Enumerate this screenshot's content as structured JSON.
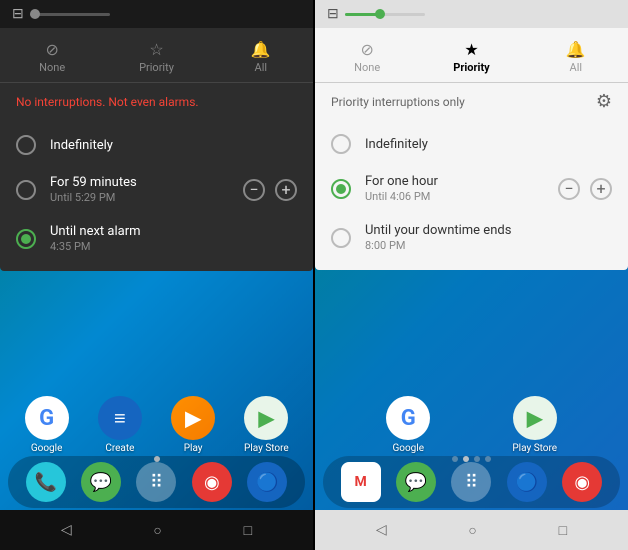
{
  "left_panel": {
    "status_bar": {
      "vibrate_symbol": "📳",
      "slider_fill_pct": 0
    },
    "tabs": [
      {
        "id": "none",
        "icon": "⊘",
        "label": "None",
        "active": false
      },
      {
        "id": "priority",
        "icon": "★",
        "label": "Priority",
        "active": false
      },
      {
        "id": "all",
        "icon": "🔔",
        "label": "All",
        "active": false
      }
    ],
    "alert_message": "No interruptions. Not even alarms.",
    "options": [
      {
        "id": "indefinitely",
        "label": "Indefinitely",
        "sub": "",
        "selected": false,
        "has_stepper": false
      },
      {
        "id": "59min",
        "label": "For 59 minutes",
        "sub": "Until 5:29 PM",
        "selected": false,
        "has_stepper": true
      },
      {
        "id": "next_alarm",
        "label": "Until next alarm",
        "sub": "4:35 PM",
        "selected": true,
        "has_stepper": false
      }
    ],
    "apps_row1": [
      {
        "name": "Google",
        "bg": "#fff",
        "text": "G",
        "text_color": "#4285F4"
      },
      {
        "name": "Create",
        "bg": "#1565C0",
        "text": "≡",
        "text_color": "#fff"
      },
      {
        "name": "Play",
        "bg": "#ff8f00",
        "text": "▶",
        "text_color": "#fff"
      },
      {
        "name": "Play Store",
        "bg": "#e8f5e9",
        "text": "▶",
        "text_color": "#4CAF50"
      }
    ],
    "nav": {
      "back": "◁",
      "home": "○",
      "recents": "□"
    }
  },
  "right_panel": {
    "status_bar": {
      "vibrate_symbol": "📳",
      "slider_fill_pct": 40
    },
    "tabs": [
      {
        "id": "none",
        "icon": "⊘",
        "label": "None",
        "active": false
      },
      {
        "id": "priority",
        "icon": "★",
        "label": "Priority",
        "active": true
      },
      {
        "id": "all",
        "icon": "🔔",
        "label": "All",
        "active": false
      }
    ],
    "priority_info": "Priority interruptions only",
    "gear_label": "⚙",
    "options": [
      {
        "id": "indefinitely",
        "label": "Indefinitely",
        "sub": "",
        "selected": false,
        "has_stepper": false
      },
      {
        "id": "one_hour",
        "label": "For one hour",
        "sub": "Until 4:06 PM",
        "selected": true,
        "has_stepper": true
      },
      {
        "id": "downtime",
        "label": "Until your downtime ends",
        "sub": "8:00 PM",
        "selected": false,
        "has_stepper": false
      }
    ],
    "apps_row1": [
      {
        "name": "Google",
        "bg": "#fff",
        "text": "G",
        "text_color": "#4285F4"
      },
      {
        "name": "Play Store",
        "bg": "#e8f5e9",
        "text": "▶",
        "text_color": "#4CAF50"
      }
    ],
    "nav": {
      "back": "◁",
      "home": "○",
      "recents": "□"
    }
  }
}
